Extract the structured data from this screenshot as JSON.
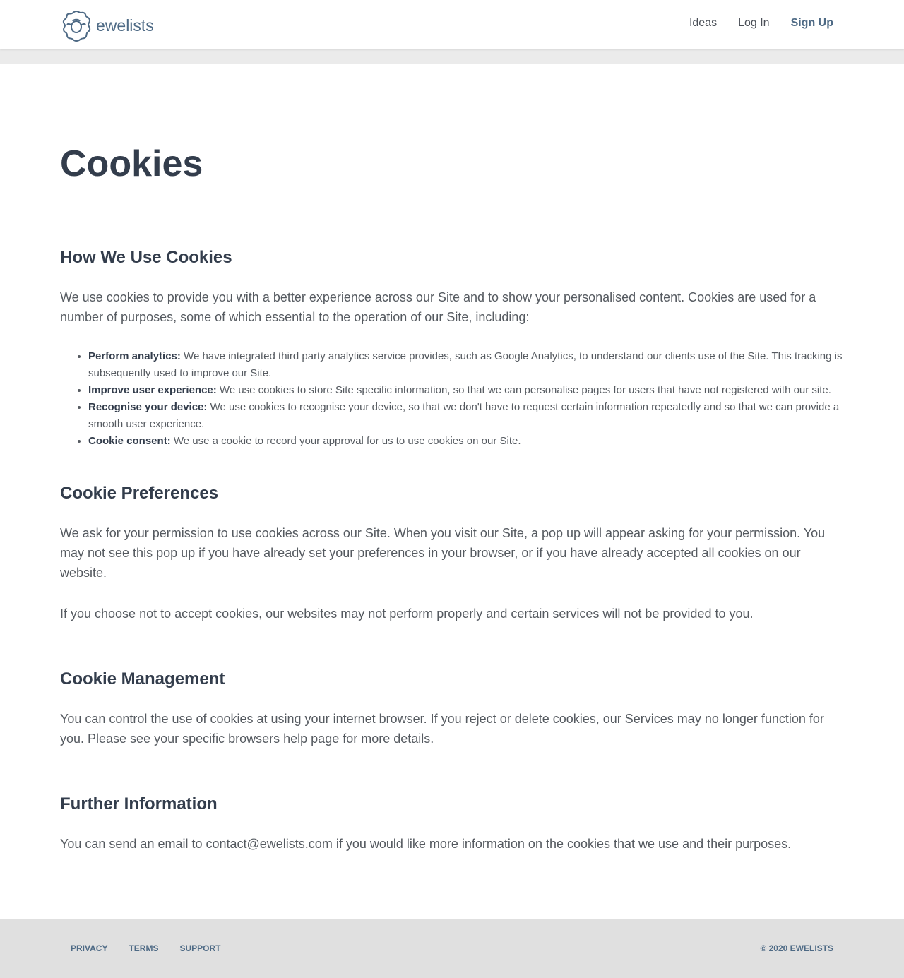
{
  "header": {
    "logo_text": "ewelists",
    "nav": [
      "Ideas",
      "Log In",
      "Sign Up"
    ]
  },
  "page_title": "Cookies",
  "sections": [
    {
      "heading": "How We Use Cookies",
      "paragraphs": [
        "We use cookies to provide you with a better experience across our Site and to show your personalised content. Cookies are used for a number of purposes, some of which essential to the operation of our Site, including:"
      ],
      "bullets": [
        {
          "label": "Perform analytics:",
          "text": " We have integrated third party analytics service provides, such as Google Analytics, to understand our clients use of the Site. This tracking is subsequently used to improve our Site."
        },
        {
          "label": "Improve user experience:",
          "text": " We use cookies to store Site specific information, so that we can personalise pages for users that have not registered with our site."
        },
        {
          "label": "Recognise your device:",
          "text": " We use cookies to recognise your device, so that we don't have to request certain information repeatedly and so that we can provide a smooth user experience."
        },
        {
          "label": "Cookie consent:",
          "text": " We use a cookie to record your approval for us to use cookies on our Site."
        }
      ]
    },
    {
      "heading": "Cookie Preferences",
      "paragraphs": [
        "We ask for your permission to use cookies across our Site. When you visit our Site, a pop up will appear asking for your permission. You may not see this pop up if you have already set your preferences in your browser, or if you have already accepted all cookies on our website.",
        "If you choose not to accept cookies, our websites may not perform properly and certain services will not be provided to you."
      ]
    },
    {
      "heading": "Cookie Management",
      "paragraphs": [
        "You can control the use of cookies at using your internet browser. If you reject or delete cookies, our Services may no longer function for you. Please see your specific browsers help page for more details."
      ]
    },
    {
      "heading": "Further Information",
      "paragraphs": [
        "You can send an email to contact@ewelists.com if you would like more information on the cookies that we use and their purposes."
      ]
    }
  ],
  "footer": {
    "links": [
      "PRIVACY",
      "TERMS",
      "SUPPORT"
    ],
    "copyright": "© 2020 EWELISTS"
  }
}
